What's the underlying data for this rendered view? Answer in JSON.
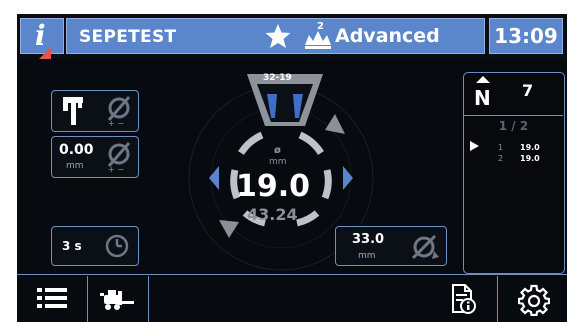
{
  "header": {
    "info_glyph": "i",
    "program_name": "SEPETEST",
    "level_superscript": "2",
    "mode_label": "Advanced",
    "time": "13:09"
  },
  "left_controls": {
    "tool_diameter_symbol": "ø",
    "tolerance_value": "0.00",
    "tolerance_unit": "mm",
    "timer_value": "3 s"
  },
  "gauge": {
    "range_label": "32-19",
    "diameter_symbol": "ø",
    "unit": "mm",
    "main_value": "19.0",
    "secondary_value": "43.24"
  },
  "right_value_box": {
    "value": "33.0",
    "unit": "mm"
  },
  "count_panel": {
    "n_value": "7",
    "page": "1 / 2",
    "rows": [
      {
        "index": "1",
        "value": "19.0"
      },
      {
        "index": "2",
        "value": "19.0"
      }
    ]
  },
  "colors": {
    "accent_blue": "#5b86cc",
    "border_blue": "#6d8fc6",
    "ring_gray": "#bfc3c9",
    "warning_red": "#e0584c"
  },
  "icons": [
    "info-icon",
    "star-icon",
    "crown-icon",
    "caliper-icon",
    "diameter-icon",
    "clock-icon",
    "list-icon",
    "forklift-icon",
    "document-info-icon",
    "gear-icon"
  ]
}
